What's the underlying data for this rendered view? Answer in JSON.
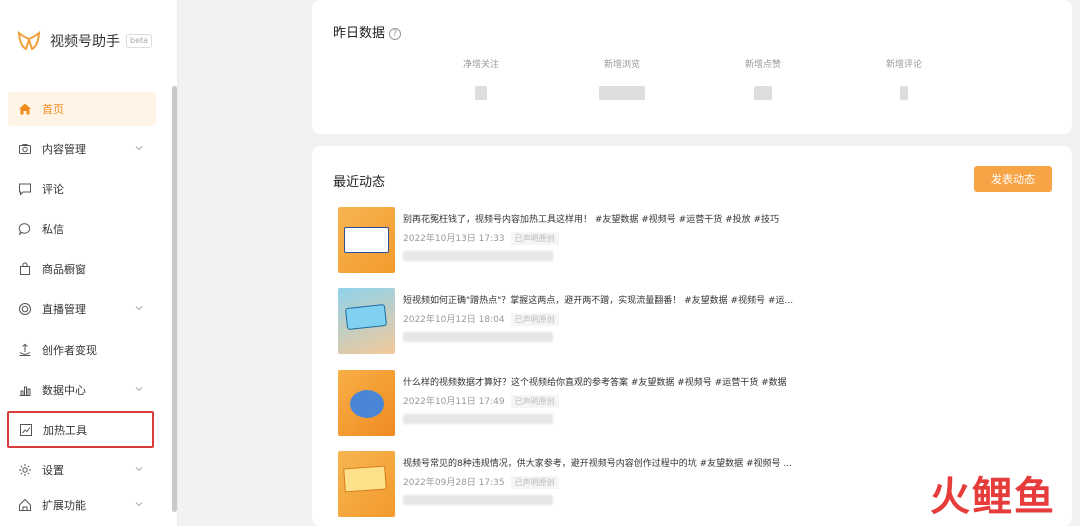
{
  "app": {
    "title": "视频号助手",
    "beta": "beta"
  },
  "sidebar": {
    "items": [
      {
        "label": "首页",
        "icon": "home-icon"
      },
      {
        "label": "内容管理",
        "icon": "camera-icon"
      },
      {
        "label": "评论",
        "icon": "comment-icon"
      },
      {
        "label": "私信",
        "icon": "message-icon"
      },
      {
        "label": "商品橱窗",
        "icon": "shopping-bag-icon"
      },
      {
        "label": "直播管理",
        "icon": "live-icon"
      },
      {
        "label": "创作者变现",
        "icon": "monetize-icon"
      },
      {
        "label": "数据中心",
        "icon": "bar-chart-icon"
      },
      {
        "label": "加热工具",
        "icon": "trend-icon"
      },
      {
        "label": "设置",
        "icon": "gear-icon"
      },
      {
        "label": "扩展功能",
        "icon": "extension-icon"
      }
    ]
  },
  "yesterday": {
    "title": "昨日数据",
    "stats": [
      {
        "label": "净增关注"
      },
      {
        "label": "新增浏览"
      },
      {
        "label": "新增点赞"
      },
      {
        "label": "新增评论"
      }
    ]
  },
  "recent": {
    "title": "最近动态",
    "publish_label": "发表动态",
    "posts": [
      {
        "title": "别再花冤枉钱了，视频号内容加热工具这样用！ #友望数据 #视频号 #运营干货 #投放 #技巧",
        "date": "2022年10月13日 17:33",
        "badge": "已声明原创"
      },
      {
        "title": "短视频如何正确\"蹭热点\"？掌握这两点，避开两不蹭，实现流量翻番！ #友望数据 #视频号 #运...",
        "date": "2022年10月12日 18:04",
        "badge": "已声明原创"
      },
      {
        "title": "什么样的视频数据才算好？这个视频给你直观的参考答案 #友望数据 #视频号 #运营干货 #数据",
        "date": "2022年10月11日 17:49",
        "badge": "已声明原创"
      },
      {
        "title": "视频号常见的8种违规情况，供大家参考，避开视频号内容创作过程中的坑 #友望数据 #视频号 ...",
        "date": "2022年09月28日 17:35",
        "badge": "已声明原创"
      }
    ]
  },
  "watermark": "火鲤鱼",
  "colors": {
    "accent": "#f7a446",
    "active_bg": "#fff4e6",
    "highlight": "#d93c3c"
  }
}
